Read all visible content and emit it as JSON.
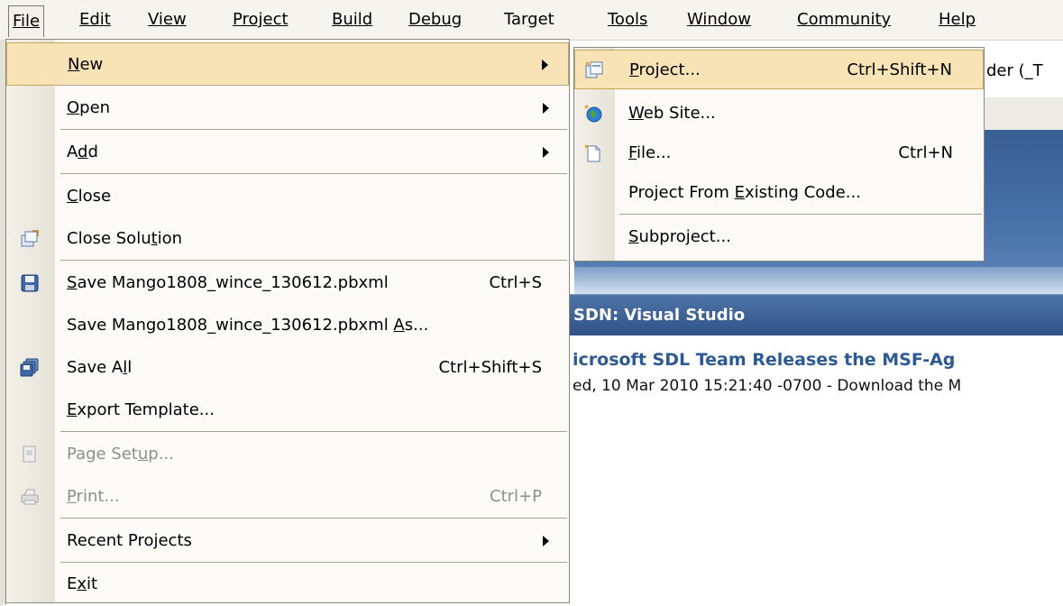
{
  "menubar": {
    "items": [
      {
        "text": "File",
        "mnemonic_index": 0
      },
      {
        "text": "Edit",
        "mnemonic_index": 0
      },
      {
        "text": "View",
        "mnemonic_index": 0
      },
      {
        "text": "Project",
        "mnemonic_index": 0
      },
      {
        "text": "Build",
        "mnemonic_index": 0
      },
      {
        "text": "Debug",
        "mnemonic_index": 0
      },
      {
        "text": "Target",
        "mnemonic_index": 3
      },
      {
        "text": "Tools",
        "mnemonic_index": 0
      },
      {
        "text": "Window",
        "mnemonic_index": 0
      },
      {
        "text": "Community",
        "mnemonic_index": 0
      },
      {
        "text": "Help",
        "mnemonic_index": 0
      }
    ]
  },
  "file_menu": {
    "items": [
      {
        "pre": "",
        "u": "N",
        "post": "ew",
        "shortcut": "",
        "submenu": true,
        "icon": "",
        "disabled": false,
        "selected": true
      },
      {
        "pre": "",
        "u": "O",
        "post": "pen",
        "shortcut": "",
        "submenu": true,
        "icon": "",
        "disabled": false
      },
      {
        "pre": "A",
        "u": "d",
        "post": "d",
        "shortcut": "",
        "submenu": true,
        "icon": "",
        "disabled": false
      },
      {
        "pre": "",
        "u": "C",
        "post": "lose",
        "shortcut": "",
        "submenu": false,
        "icon": "",
        "disabled": false
      },
      {
        "pre": "Close Solu",
        "u": "t",
        "post": "ion",
        "shortcut": "",
        "submenu": false,
        "icon": "close-solution-icon",
        "disabled": false
      },
      {
        "pre": "",
        "u": "S",
        "post": "ave Mango1808_wince_130612.pbxml",
        "shortcut": "Ctrl+S",
        "submenu": false,
        "icon": "save-icon",
        "disabled": false
      },
      {
        "pre": "Save Mango1808_wince_130612.pbxml ",
        "u": "A",
        "post": "s...",
        "shortcut": "",
        "submenu": false,
        "icon": "",
        "disabled": false
      },
      {
        "pre": "Save A",
        "u": "l",
        "post": "l",
        "shortcut": "Ctrl+Shift+S",
        "submenu": false,
        "icon": "save-all-icon",
        "disabled": false
      },
      {
        "pre": "",
        "u": "E",
        "post": "xport Template...",
        "shortcut": "",
        "submenu": false,
        "icon": "",
        "disabled": false
      },
      {
        "pre": "Page Set",
        "u": "u",
        "post": "p...",
        "shortcut": "",
        "submenu": false,
        "icon": "page-setup-icon",
        "disabled": true
      },
      {
        "pre": "",
        "u": "P",
        "post": "rint...",
        "shortcut": "Ctrl+P",
        "submenu": false,
        "icon": "print-icon",
        "disabled": true
      },
      {
        "pre": "Recent Projects",
        "u": "",
        "post": "",
        "shortcut": "",
        "submenu": true,
        "icon": "",
        "disabled": false
      },
      {
        "pre": "E",
        "u": "x",
        "post": "it",
        "shortcut": "",
        "submenu": false,
        "icon": "",
        "disabled": false
      }
    ]
  },
  "new_submenu": {
    "items": [
      {
        "pre": "",
        "u": "P",
        "post": "roject...",
        "shortcut": "Ctrl+Shift+N",
        "icon": "new-project-icon",
        "selected": true
      },
      {
        "pre": "",
        "u": "W",
        "post": "eb Site...",
        "shortcut": "",
        "icon": "web-site-icon"
      },
      {
        "pre": "",
        "u": "F",
        "post": "ile...",
        "shortcut": "Ctrl+N",
        "icon": "new-file-icon"
      },
      {
        "pre": "Project From ",
        "u": "E",
        "post": "xisting Code...",
        "shortcut": "",
        "icon": ""
      },
      {
        "pre": "",
        "u": "S",
        "post": "ubproject...",
        "shortcut": "",
        "icon": ""
      }
    ]
  },
  "background": {
    "title_fragment": "der (_T",
    "section_header": "SDN: Visual Studio",
    "headline": "icrosoft SDL Team Releases the MSF-Ag",
    "dateline": "ed, 10 Mar 2010 15:21:40 -0700 -  Download the M"
  },
  "colors": {
    "menu_bg": "#fbfaf6",
    "highlight_bg": "#f7e3b5",
    "highlight_border": "#c9a65a",
    "banner_blue": "#3a5f95",
    "headline_blue": "#2e5a94"
  }
}
